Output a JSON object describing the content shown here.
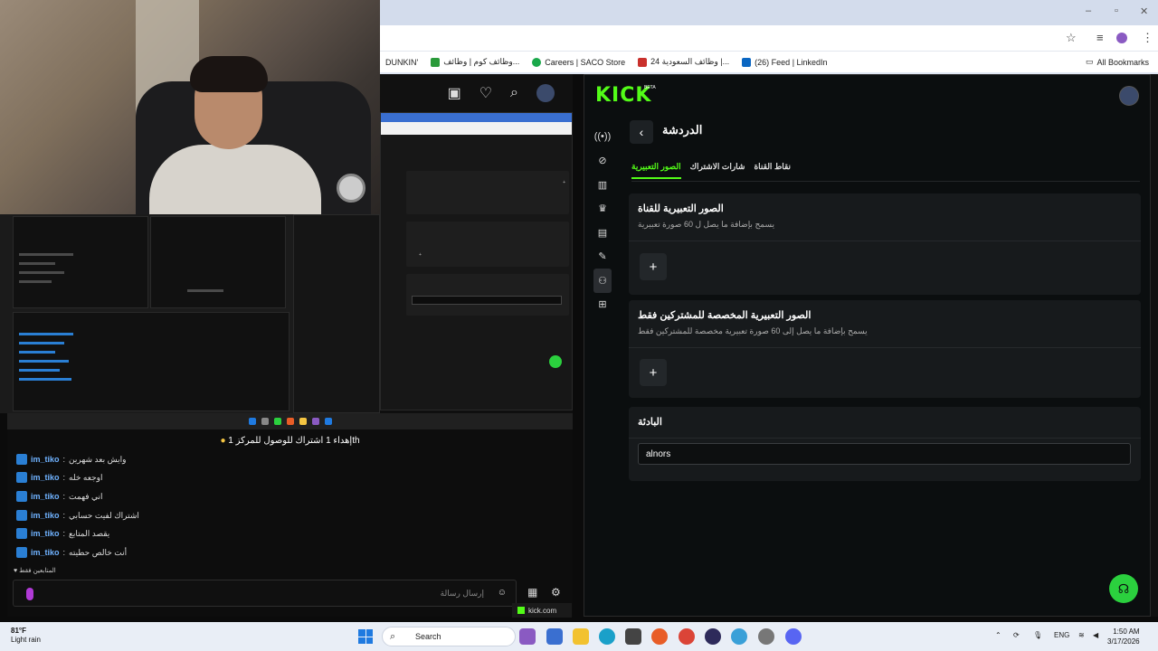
{
  "browser": {
    "bookmarks": [
      {
        "label": "DUNKIN'",
        "color": "#f08a1a"
      },
      {
        "label": "وظائف كوم | وظائف...",
        "color": "#2a9a3a"
      },
      {
        "label": "Careers | SACO Store",
        "color": "#1aa84a"
      },
      {
        "label": "وظائف السعودية 24 |...",
        "color": "#c9302c"
      },
      {
        "label": "(26) Feed | LinkedIn",
        "color": "#0a66c2"
      }
    ],
    "all_bookmarks": "All Bookmarks"
  },
  "stream_chat": {
    "pinned": "إهداء 1 اشتراك للوصول للمركز 1",
    "pinned_suffix": "th",
    "messages": [
      {
        "user": "im_tiko",
        "text": "وايش بعد شهرين"
      },
      {
        "user": "im_tiko",
        "text": "اوجعه خله"
      },
      {
        "user": "im_tiko",
        "text": "اني فهمت"
      },
      {
        "user": "im_tiko",
        "text": "اشتراك لفيت حسابي"
      },
      {
        "user": "im_tiko",
        "text": "يقصد المتابع"
      },
      {
        "user": "im_tiko",
        "text": "أنت خالص حطيته"
      }
    ],
    "sub_mode": "المتابعين فقط",
    "input_placeholder": "إرسال رسالة",
    "kick_tab": "kick.com"
  },
  "kick": {
    "logo": "KICK",
    "beta": "BETA",
    "page_title": "الدردشة",
    "tabs": [
      "الصور التعبيرية",
      "شارات الاشتراك",
      "نقاط القناة"
    ],
    "active_tab": 0,
    "channel_emotes": {
      "title": "الصور التعبيرية للقناة",
      "desc": "يسمح بإضافة ما يصل ل 60 صورة تعبيرية"
    },
    "sub_emotes": {
      "title": "الصور التعبيرية المخصصة للمشتركين فقط",
      "desc": "يسمح بإضافة ما يصل إلى 60 صورة تعبيرية مخصصة للمشتركين فقط"
    },
    "bio": {
      "title": "البادئة",
      "value": "alnors"
    },
    "add_label": "+"
  },
  "taskbar": {
    "temp": "81°F",
    "weather": "Light rain",
    "search": "Search",
    "lang": "ENG",
    "time": "1:50 AM",
    "date": "3/17/2026"
  }
}
